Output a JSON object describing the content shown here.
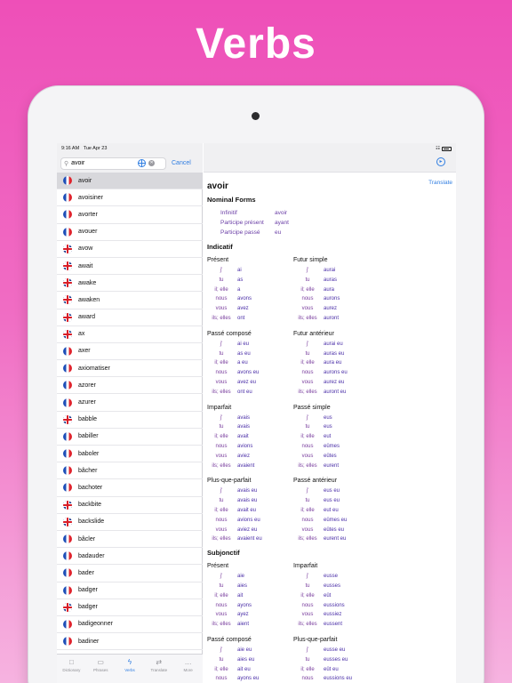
{
  "hero_title": "Verbs",
  "status": {
    "time": "9:16 AM",
    "date": "Tue Apr 23"
  },
  "search": {
    "value": "avoir",
    "cancel_label": "Cancel"
  },
  "word_list": [
    {
      "word": "avoir",
      "lang": "fr",
      "selected": true
    },
    {
      "word": "avoisiner",
      "lang": "fr"
    },
    {
      "word": "avorter",
      "lang": "fr"
    },
    {
      "word": "avouer",
      "lang": "fr"
    },
    {
      "word": "avow",
      "lang": "uk"
    },
    {
      "word": "await",
      "lang": "uk"
    },
    {
      "word": "awake",
      "lang": "uk"
    },
    {
      "word": "awaken",
      "lang": "uk"
    },
    {
      "word": "award",
      "lang": "uk"
    },
    {
      "word": "ax",
      "lang": "uk"
    },
    {
      "word": "axer",
      "lang": "fr"
    },
    {
      "word": "axiomatiser",
      "lang": "fr"
    },
    {
      "word": "azorer",
      "lang": "fr"
    },
    {
      "word": "azurer",
      "lang": "fr"
    },
    {
      "word": "babble",
      "lang": "uk"
    },
    {
      "word": "babiller",
      "lang": "fr"
    },
    {
      "word": "baboler",
      "lang": "fr"
    },
    {
      "word": "bâcher",
      "lang": "fr"
    },
    {
      "word": "bachoter",
      "lang": "fr"
    },
    {
      "word": "backbite",
      "lang": "uk"
    },
    {
      "word": "backslide",
      "lang": "uk"
    },
    {
      "word": "bâcler",
      "lang": "fr"
    },
    {
      "word": "badauder",
      "lang": "fr"
    },
    {
      "word": "bader",
      "lang": "fr"
    },
    {
      "word": "badger",
      "lang": "fr"
    },
    {
      "word": "badger",
      "lang": "uk"
    },
    {
      "word": "badigeonner",
      "lang": "fr"
    },
    {
      "word": "badiner",
      "lang": "fr"
    }
  ],
  "tabs": [
    {
      "label": "Dictionary",
      "icon": "book-icon"
    },
    {
      "label": "Phrases",
      "icon": "speech-bubble-icon"
    },
    {
      "label": "Verbs",
      "icon": "bolt-icon",
      "active": true
    },
    {
      "label": "Translate",
      "icon": "arrows-icon"
    },
    {
      "label": "More",
      "icon": "ellipsis-icon"
    }
  ],
  "detail": {
    "headword": "avoir",
    "translate_label": "Translate",
    "nominal_title": "Nominal Forms",
    "nominal": [
      {
        "label": "Infinitif",
        "value": "avoir"
      },
      {
        "label": "Participe présent",
        "value": "ayant"
      },
      {
        "label": "Participe passé",
        "value": "eu"
      }
    ],
    "moods": [
      {
        "title": "Indicatif",
        "tenses": [
          {
            "name": "Présent",
            "forms": [
              "ai",
              "as",
              "a",
              "avons",
              "avez",
              "ont"
            ],
            "j": "j'"
          },
          {
            "name": "Futur simple",
            "forms": [
              "aurai",
              "auras",
              "aura",
              "aurons",
              "aurez",
              "auront"
            ],
            "j": "j'"
          },
          {
            "name": "Passé composé",
            "forms": [
              "ai eu",
              "as eu",
              "a eu",
              "avons eu",
              "avez eu",
              "ont eu"
            ],
            "j": "j'"
          },
          {
            "name": "Futur antérieur",
            "forms": [
              "aurai eu",
              "auras eu",
              "aura eu",
              "aurons eu",
              "aurez eu",
              "auront eu"
            ],
            "j": "j'"
          },
          {
            "name": "Imparfait",
            "forms": [
              "avais",
              "avais",
              "avait",
              "avions",
              "aviez",
              "avaient"
            ],
            "j": "j'"
          },
          {
            "name": "Passé simple",
            "forms": [
              "eus",
              "eus",
              "eut",
              "eûmes",
              "eûtes",
              "eurent"
            ],
            "j": "j'"
          },
          {
            "name": "Plus-que-parfait",
            "forms": [
              "avais eu",
              "avais eu",
              "avait eu",
              "avions eu",
              "aviez eu",
              "avaient eu"
            ],
            "j": "j'"
          },
          {
            "name": "Passé antérieur",
            "forms": [
              "eus eu",
              "eus eu",
              "eut eu",
              "eûmes eu",
              "eûtes eu",
              "eurent eu"
            ],
            "j": "j'"
          }
        ]
      },
      {
        "title": "Subjonctif",
        "tenses": [
          {
            "name": "Présent",
            "forms": [
              "aie",
              "aies",
              "ait",
              "ayons",
              "ayez",
              "aient"
            ],
            "j": "j'"
          },
          {
            "name": "Imparfait",
            "forms": [
              "eusse",
              "eusses",
              "eût",
              "eussions",
              "eussiez",
              "eussent"
            ],
            "j": "j'"
          },
          {
            "name": "Passé composé",
            "forms": [
              "aie eu",
              "aies eu",
              "ait eu",
              "ayons eu"
            ],
            "j": "j'"
          },
          {
            "name": "Plus-que-parfait",
            "forms": [
              "eusse eu",
              "eusses eu",
              "eût eu",
              "eussions eu"
            ],
            "j": "j'"
          }
        ]
      }
    ],
    "pronouns": [
      "tu",
      "il; elle",
      "nous",
      "vous",
      "ils; elles"
    ]
  }
}
